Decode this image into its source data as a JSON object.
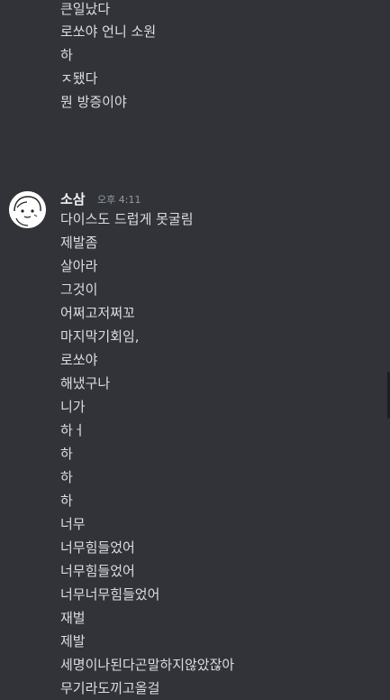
{
  "top_messages": [
    "큰일났다",
    "로쏘야 언니 소원",
    "하",
    "ㅈ됐다",
    "뭔 방증이야"
  ],
  "group": {
    "username": "소삼",
    "timestamp": "오후 4:11",
    "avatar_icon": "cartoon-face-avatar"
  },
  "group_messages": [
    "다이스도 드럽게 못굴림",
    "제발좀",
    "살아라",
    "그것이",
    "어쩌고저쩌꼬",
    "마지막기회임,",
    "로쏘야",
    "해냈구나",
    "니가",
    "하ㅓ",
    "하",
    "하",
    "하",
    "너무",
    "너무힘들었어",
    "너무힘들었어",
    "너무너무힘들었어",
    "재벌",
    "제발",
    "세명이나된다곤말하지않았잖아",
    "무기라도끼고올걸"
  ],
  "colors": {
    "background": "#313338",
    "text": "#dbdee1",
    "username": "#f2f3f5",
    "timestamp": "#949ba4"
  }
}
